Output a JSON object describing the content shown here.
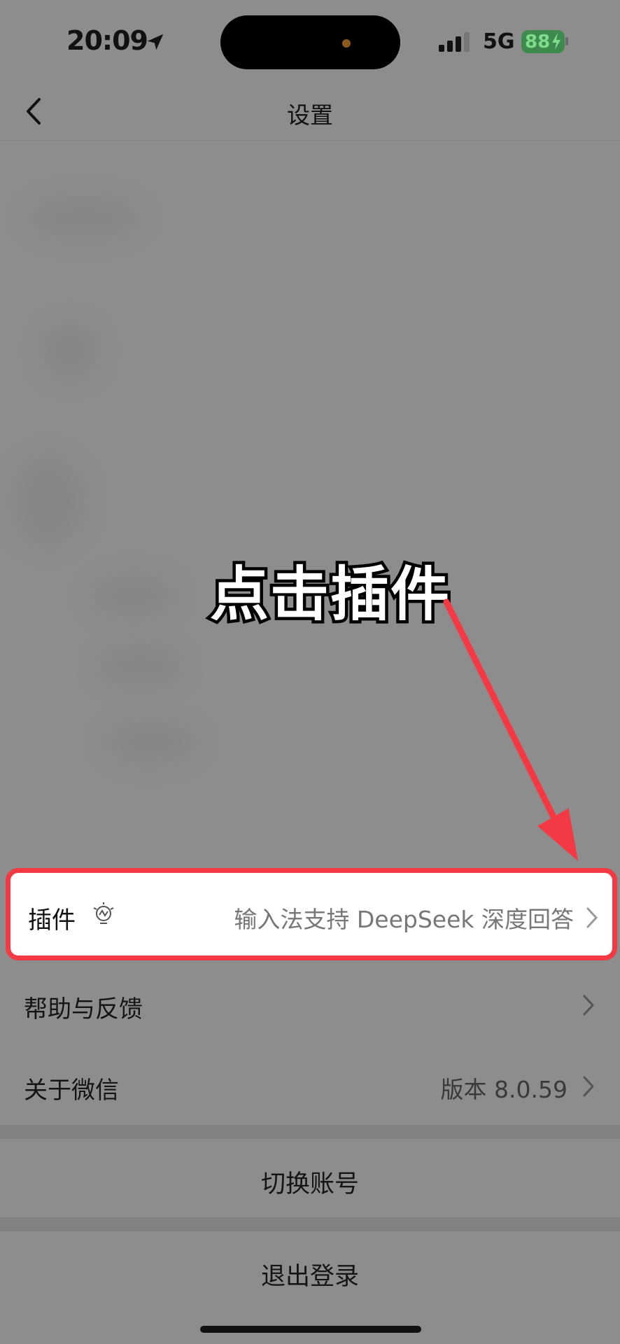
{
  "status_bar": {
    "time": "20:09",
    "network": "5G",
    "battery": "88"
  },
  "nav": {
    "title": "设置"
  },
  "annotation": {
    "callout": "点击插件",
    "color": "#f33a44"
  },
  "settings": {
    "plugin": {
      "label": "插件",
      "value": "输入法支持 DeepSeek 深度回答"
    },
    "help": {
      "label": "帮助与反馈"
    },
    "about": {
      "label": "关于微信",
      "value": "版本 8.0.59"
    }
  },
  "actions": {
    "switch_account": "切换账号",
    "logout": "退出登录"
  }
}
